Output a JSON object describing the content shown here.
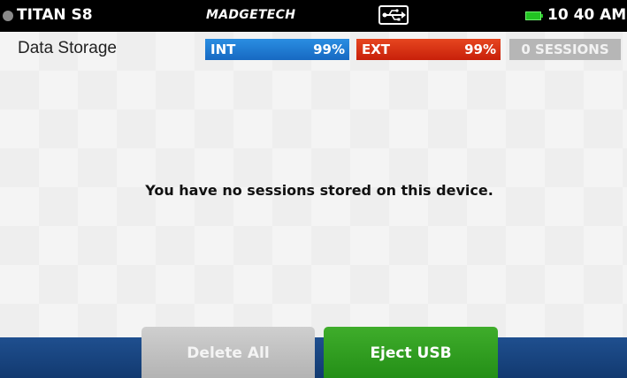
{
  "status_bar": {
    "device_name": "TITAN S8",
    "brand": "MADGETECH",
    "time": "10 40 AM",
    "icons": [
      "device-status-dot",
      "usb-icon",
      "battery-icon"
    ],
    "battery_color": "#22c322"
  },
  "page": {
    "title": "Data Storage",
    "int": {
      "label": "INT",
      "percent": "99%",
      "color": "#1e7ed6"
    },
    "ext": {
      "label": "EXT",
      "percent": "99%",
      "color": "#d93414"
    },
    "sessions": "0 SESSIONS",
    "empty_message": "You have no sessions stored on this device."
  },
  "actions": {
    "delete_all": "Delete All",
    "eject_usb": "Eject USB"
  },
  "colors": {
    "bottom_bar": "#1a4680",
    "eject_button": "#2e9c1f",
    "delete_button_disabled": "#bdbdbd"
  }
}
